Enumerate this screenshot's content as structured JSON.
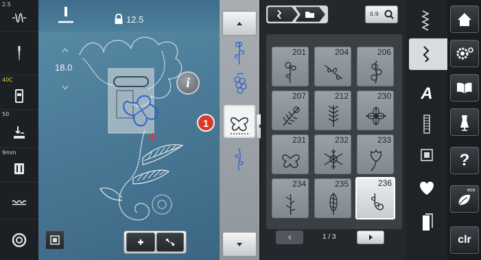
{
  "left_bar": {
    "stitch_width": "2.5",
    "tension": "40C",
    "presser_pressure": "50",
    "thread_cut": "9mm"
  },
  "work_area": {
    "stitch_length": "12.5",
    "value_right": "18.0",
    "info_label": "i"
  },
  "callout": {
    "number": "1"
  },
  "panel": {
    "zoom": "0.9",
    "page": "1 / 3",
    "stitches": [
      "201",
      "204",
      "206",
      "207",
      "212",
      "230",
      "231",
      "232",
      "233",
      "234",
      "235",
      "236"
    ],
    "selected_stitch": "236"
  },
  "nav": {
    "eco_label": "eco",
    "clr_label": "clr",
    "help_label": "?"
  },
  "colors": {
    "accent": "#d93a2a",
    "work_bg": "#5a8da7",
    "stitch_line": "#e8eef2",
    "blue_stitch": "#2e63c9",
    "crosshair": "#d63a3a"
  }
}
